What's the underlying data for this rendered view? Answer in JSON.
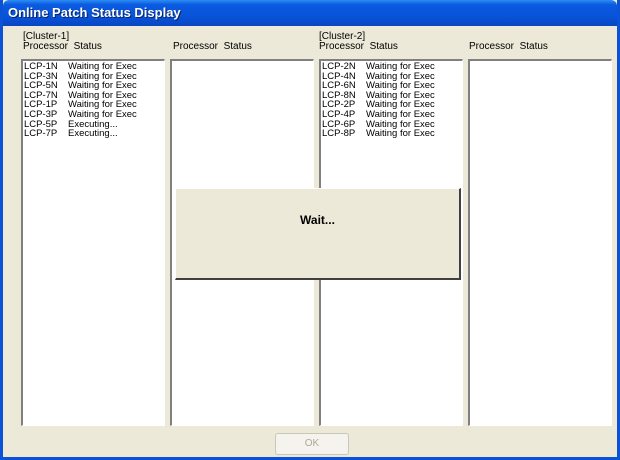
{
  "window": {
    "title": "Online Patch Status Display"
  },
  "columns": [
    {
      "cluster": "[Cluster-1]",
      "header": "Processor  Status"
    },
    {
      "cluster": "",
      "header": "Processor  Status"
    },
    {
      "cluster": "[Cluster-2]",
      "header": "Processor  Status"
    },
    {
      "cluster": "",
      "header": "Processor  Status"
    }
  ],
  "lists": {
    "cluster1": [
      {
        "processor": "LCP-1N",
        "status": "Waiting for Exec"
      },
      {
        "processor": "LCP-3N",
        "status": "Waiting for Exec"
      },
      {
        "processor": "LCP-5N",
        "status": "Waiting for Exec"
      },
      {
        "processor": "LCP-7N",
        "status": "Waiting for Exec"
      },
      {
        "processor": "LCP-1P",
        "status": "Waiting for Exec"
      },
      {
        "processor": "LCP-3P",
        "status": "Waiting for Exec"
      },
      {
        "processor": "LCP-5P",
        "status": "Executing..."
      },
      {
        "processor": "LCP-7P",
        "status": "Executing..."
      }
    ],
    "cluster2": [
      {
        "processor": "LCP-2N",
        "status": "Waiting for Exec"
      },
      {
        "processor": "LCP-4N",
        "status": "Waiting for Exec"
      },
      {
        "processor": "LCP-6N",
        "status": "Waiting for Exec"
      },
      {
        "processor": "LCP-8N",
        "status": "Waiting for Exec"
      },
      {
        "processor": "LCP-2P",
        "status": "Waiting for Exec"
      },
      {
        "processor": "LCP-4P",
        "status": "Waiting for Exec"
      },
      {
        "processor": "LCP-6P",
        "status": "Waiting for Exec"
      },
      {
        "processor": "LCP-8P",
        "status": "Waiting for Exec"
      }
    ]
  },
  "dialog": {
    "message": "Wait..."
  },
  "buttons": {
    "ok_label": "OK",
    "ok_enabled": false
  },
  "colors": {
    "titlebar": "#0854d9",
    "face": "#ece9d8",
    "list_bg": "#ffffff"
  }
}
